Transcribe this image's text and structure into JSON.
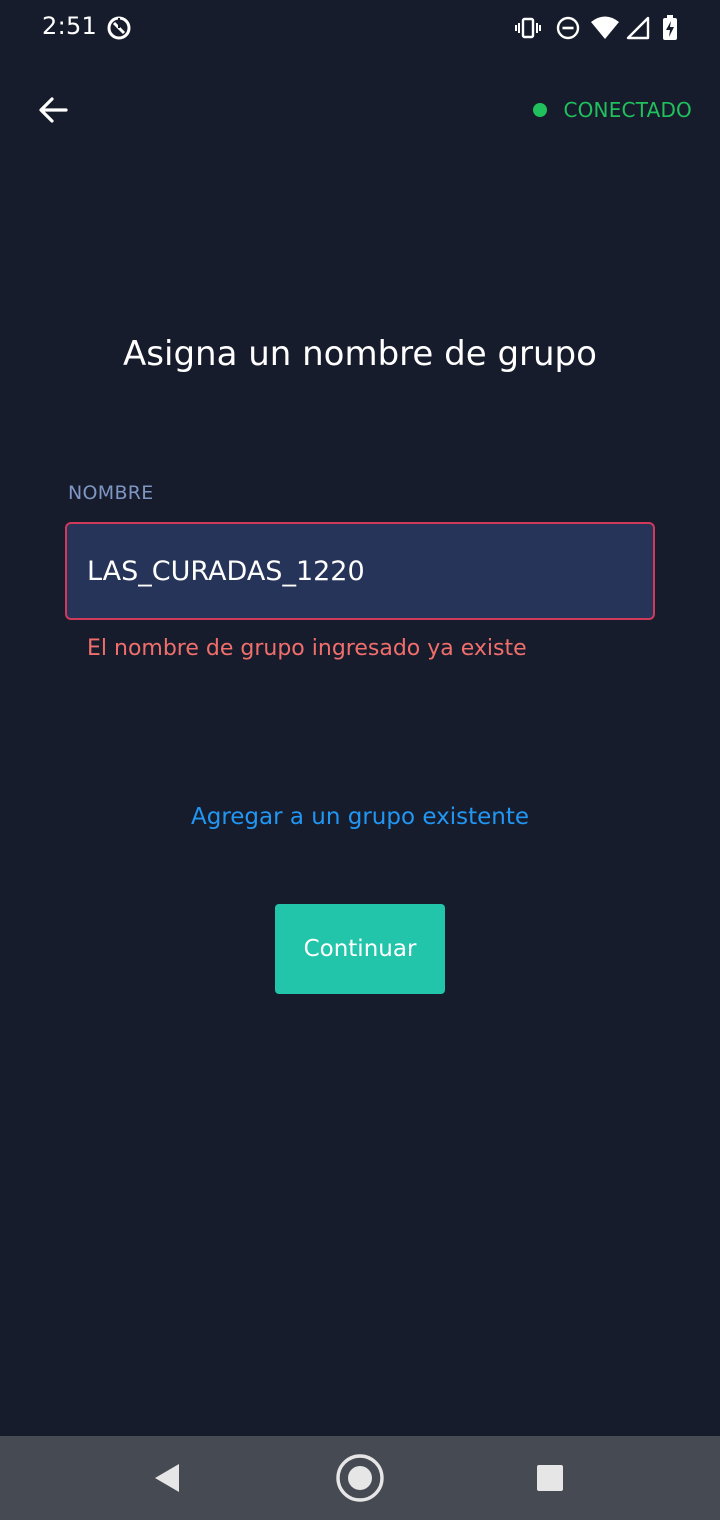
{
  "status_bar": {
    "time": "2:51",
    "icons": [
      "data-saver-icon",
      "vibrate-icon",
      "do-not-disturb-icon",
      "wifi-icon",
      "cellular-signal-icon",
      "battery-charging-icon"
    ]
  },
  "app_bar": {
    "back_icon": "arrow-left-icon",
    "connection_status": "CONECTADO",
    "connection_color": "#20c05c"
  },
  "main": {
    "title": "Asigna un nombre de grupo",
    "field": {
      "label": "NOMBRE",
      "value": "LAS_CURADAS_1220",
      "error": "El nombre de grupo ingresado ya existe",
      "error_color": "#f06e6b"
    },
    "existing_group_link": "Agregar a un grupo existente",
    "continue_button": "Continuar",
    "accent_color": "#22c5a9"
  },
  "nav_bar": {
    "icons": [
      "nav-back-icon",
      "nav-home-icon",
      "nav-recents-icon"
    ]
  }
}
